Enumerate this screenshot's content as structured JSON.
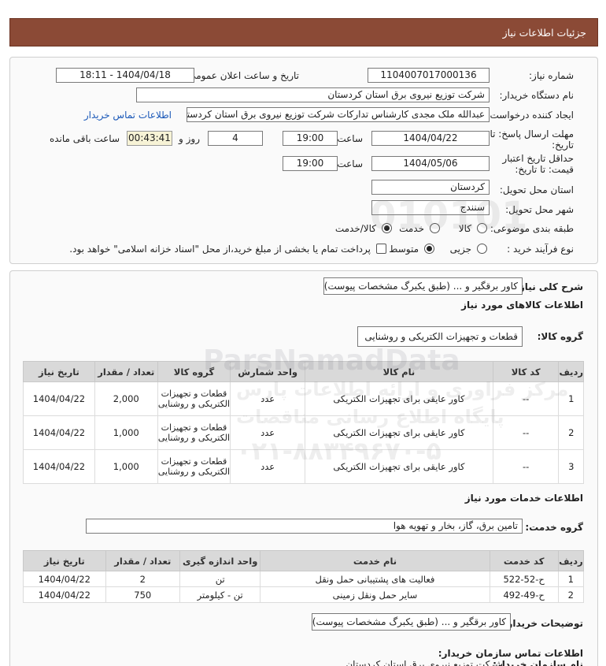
{
  "header": {
    "title": "جزئیات اطلاعات نیاز"
  },
  "form": {
    "need_number_label": "شماره نیاز:",
    "need_number": "1104007017000136",
    "announce_label": "تاریخ و ساعت اعلان عمومی:",
    "announce_value": "1404/04/18 - 18:11",
    "buyer_org_label": "نام دستگاه خریدار:",
    "buyer_org": "شرکت توزیع نیروی برق استان کردستان",
    "creator_label": "ایجاد کننده درخواست:",
    "creator": "عبدالله ملک مجدی کارشناس تدارکات شرکت توزیع نیروی برق استان کردستان",
    "contact_link": "اطلاعات تماس خریدار",
    "deadline_label_1": "مهلت ارسال پاسخ: تا",
    "deadline_label_2": "تاریخ:",
    "deadline_date": "1404/04/22",
    "time_label": "ساعت",
    "deadline_time": "19:00",
    "days_value": "4",
    "days_label": "روز و",
    "timer": "00:43:41",
    "remaining_label": "ساعت باقی مانده",
    "validity_label_1": "حداقل تاریخ اعتبار",
    "validity_label_2": "قیمت: تا تاریخ:",
    "validity_date": "1404/05/06",
    "validity_time": "19:00",
    "province_label": "استان محل تحویل:",
    "province": "کردستان",
    "city_label": "شهر محل تحویل:",
    "city": "سنندج",
    "category_label": "طبقه بندی موضوعی:",
    "category_options": [
      "کالا",
      "خدمت",
      "کالا/خدمت"
    ],
    "category_selected": "کالا/خدمت",
    "process_label": "نوع فرآیند خرید :",
    "process_options": [
      "جزیی",
      "متوسط"
    ],
    "process_selected": "متوسط",
    "treasury_note": "پرداخت تمام یا بخشی از مبلغ خرید،از محل \"اسناد خزانه اسلامی\" خواهد بود."
  },
  "details": {
    "summary_label": "شرح کلی نیاز:",
    "summary": "کاور برقگیر و ... (طبق یکبرگ مشخصات پیوست)",
    "goods_section_title": "اطلاعات کالاهای مورد نیاز",
    "goods_group_label": "گروه کالا:",
    "goods_group": "قطعات و تجهیزات الکتریکی و روشنایی",
    "goods_headers": [
      "ردیف",
      "کد کالا",
      "نام کالا",
      "واحد شمارش",
      "گروه کالا",
      "تعداد / مقدار",
      "تاریخ نیاز"
    ],
    "goods_rows": [
      [
        "1",
        "--",
        "کاور عایقی برای تجهیزات الکتریکی",
        "عدد",
        "قطعات و تجهیزات الکتریکی و روشنایی",
        "2,000",
        "1404/04/22"
      ],
      [
        "2",
        "--",
        "کاور عایقی برای تجهیزات الکتریکی",
        "عدد",
        "قطعات و تجهیزات الکتریکی و روشنایی",
        "1,000",
        "1404/04/22"
      ],
      [
        "3",
        "--",
        "کاور عایقی برای تجهیزات الکتریکی",
        "عدد",
        "قطعات و تجهیزات الکتریکی و روشنایی",
        "1,000",
        "1404/04/22"
      ]
    ],
    "services_section_title": "اطلاعات خدمات مورد نیاز",
    "service_group_label": "گروه خدمت:",
    "service_group": "تامین برق، گاز، بخار و تهویه هوا",
    "services_headers": [
      "ردیف",
      "کد خدمت",
      "نام خدمت",
      "واحد اندازه گیری",
      "تعداد / مقدار",
      "تاریخ نیاز"
    ],
    "services_rows": [
      [
        "1",
        "ح-52-522",
        "فعالیت های پشتیبانی حمل ونقل",
        "تن",
        "2",
        "1404/04/22"
      ],
      [
        "2",
        "ح-49-492",
        "سایر حمل ونقل زمینی",
        "تن - کیلومتر",
        "750",
        "1404/04/22"
      ]
    ],
    "buyer_notes_label": "توضیحات خریدار:",
    "buyer_notes": "کاور برقگیر و ... (طبق یکبرگ مشخصات پیوست)",
    "buyer_contact_title": "اطلاعات تماس سازمان خریدار:",
    "buyer_name_label": "نام سازمان خریدار:",
    "buyer_name": "شرکت توزیع نیروی برق استان کردستان"
  },
  "watermark": {
    "brand": "ParsNamadData",
    "text": "مرکز فراوری و ارائه اطلاعات پارس",
    "sub": "پایگاه اطلاع رسانی مناقصات",
    "phone": "۰۲۱-۸۸۳۴۹۶۷۰-۵",
    "num": "010101"
  }
}
